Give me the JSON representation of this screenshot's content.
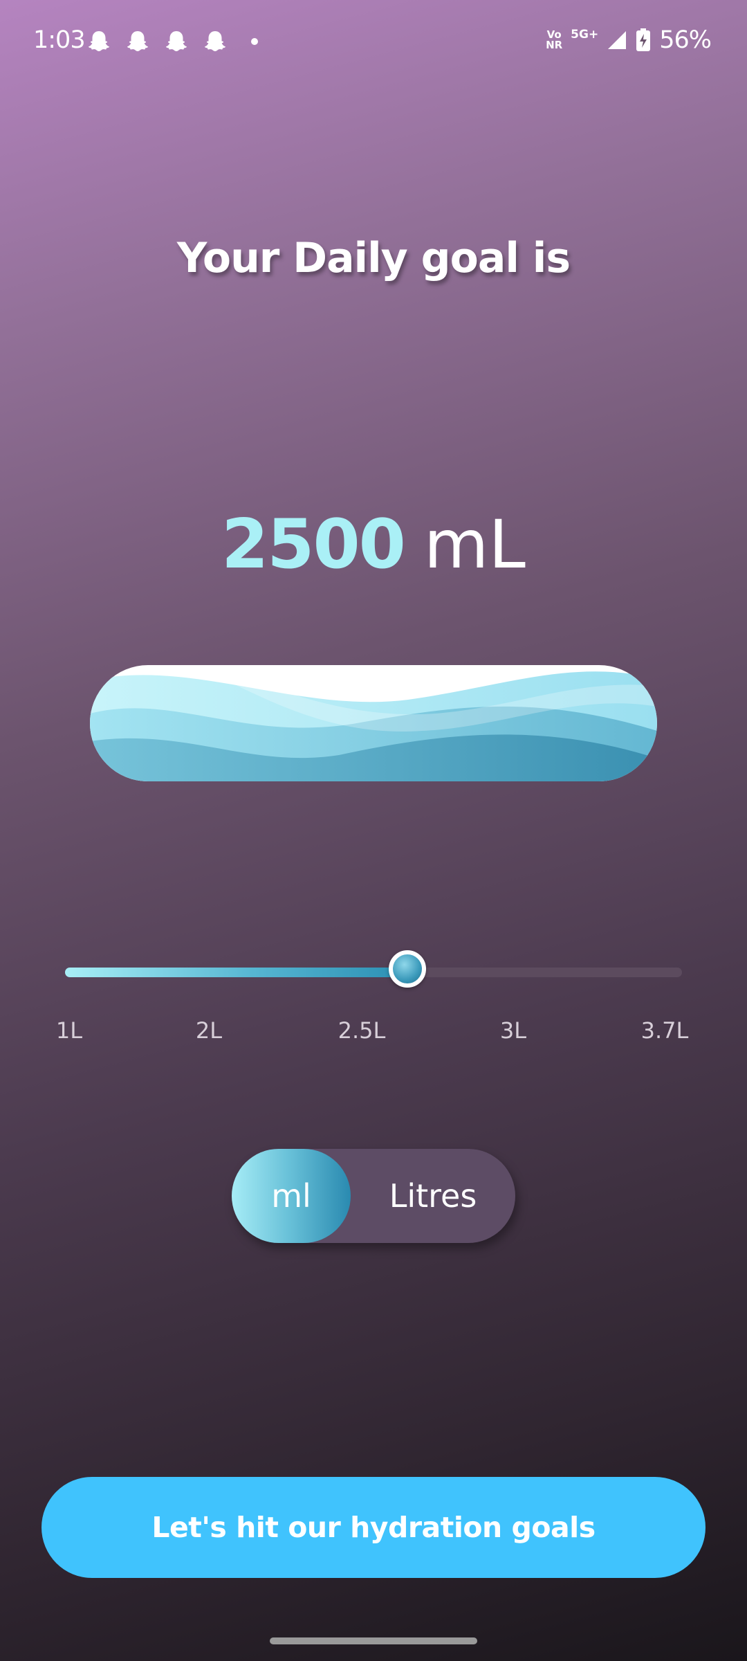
{
  "status_bar": {
    "time": "1:03",
    "notification_icons": [
      "snapchat-icon",
      "snapchat-icon",
      "snapchat-icon",
      "snapchat-icon",
      "more-dot-icon"
    ],
    "volte_line1": "Vo",
    "volte_line2": "NR",
    "network": "5G+",
    "battery": "56%"
  },
  "title": "Your Daily goal is",
  "goal": {
    "value": "2500",
    "unit": "mL"
  },
  "slider": {
    "value_fraction": 0.555,
    "labels": [
      "1L",
      "2L",
      "2.5L",
      "3L",
      "3.7L"
    ]
  },
  "unit_toggle": {
    "options": [
      "ml",
      "Litres"
    ],
    "selected": "ml"
  },
  "cta_label": "Let's hit our hydration goals",
  "colors": {
    "accent": "#40c3fd",
    "goal_number": "#aaf0f6",
    "water_light": "#bdeef6",
    "water_dark": "#2f86a8"
  }
}
